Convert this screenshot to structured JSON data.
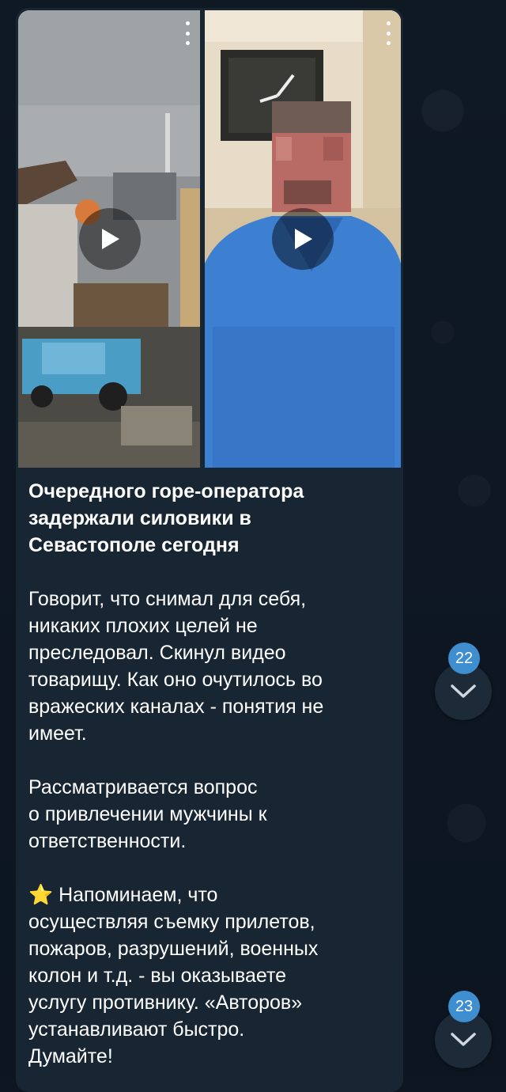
{
  "message": {
    "title_lines": [
      "Очередного горе-оператора",
      "задержали силовики в",
      "Севастополе сегодня"
    ],
    "paragraph1_lines": [
      "Говорит, что снимал для себя,",
      "никаких плохих целей не",
      "преследовал. Скинул видео",
      "товарищу. Как оно очутилось во",
      "вражеских каналах - понятия не",
      "имеет."
    ],
    "paragraph2_lines": [
      "Рассматривается вопрос",
      "о привлечении мужчины к",
      "ответственности."
    ],
    "star_emoji": "⭐",
    "paragraph3_lines": [
      "Напоминаем, что",
      "осуществляя съемку прилетов,",
      "пожаров, разрушений, военных",
      "колон и т.д. - вы оказываете",
      "услугу противнику. «Авторов»",
      "устанавливают быстро.",
      "Думайте!"
    ]
  },
  "media": [
    {
      "type": "video",
      "icon": "play-icon"
    },
    {
      "type": "video",
      "icon": "play-icon"
    }
  ],
  "scroll_buttons": [
    {
      "badge": "22",
      "icon": "chevron-down-icon"
    },
    {
      "badge": "23",
      "icon": "chevron-down-icon"
    }
  ],
  "colors": {
    "background": "#0e1621",
    "bubble": "#182533",
    "badge": "#3e8ed0",
    "text": "#ffffff"
  }
}
